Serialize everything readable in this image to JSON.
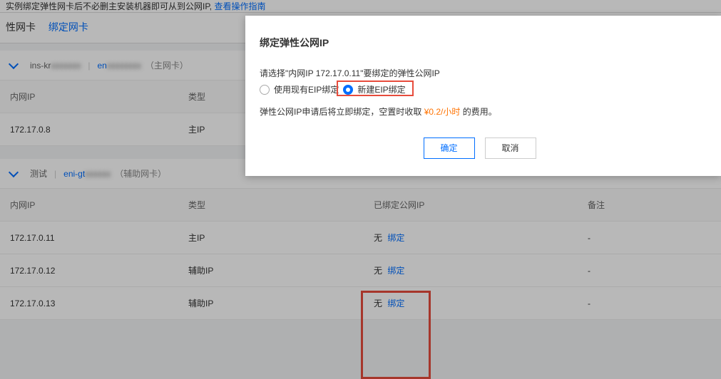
{
  "top_bar": {
    "left_text": "实例绑定弹性网卡后不必删主安装机器即可从到公网IP, ",
    "link": "查看操作指南"
  },
  "panel": {
    "title": "性网卡",
    "bind_link": "绑定网卡"
  },
  "card1": {
    "instance_prefix": "ins-kr",
    "eni_prefix": "en",
    "role": "（主网卡）",
    "headers": {
      "ip": "内网IP",
      "type": "类型"
    },
    "rows": [
      {
        "ip": "172.17.0.8",
        "type": "主IP"
      }
    ]
  },
  "card2": {
    "label": "测试",
    "eni_prefix": "eni-gt",
    "role": "（辅助网卡）",
    "headers": {
      "ip": "内网IP",
      "type": "类型",
      "eip": "已绑定公网IP",
      "note": "备注"
    },
    "rows": [
      {
        "ip": "172.17.0.11",
        "type": "主IP",
        "eip_none": "无",
        "eip_bind": "绑定",
        "note": "-"
      },
      {
        "ip": "172.17.0.12",
        "type": "辅助IP",
        "eip_none": "无",
        "eip_bind": "绑定",
        "note": "-"
      },
      {
        "ip": "172.17.0.13",
        "type": "辅助IP",
        "eip_none": "无",
        "eip_bind": "绑定",
        "note": "-"
      }
    ]
  },
  "modal": {
    "title": "绑定弹性公网IP",
    "subtitle": "请选择\"内网IP 172.17.0.11\"要绑定的弹性公网IP",
    "radio_existing": "使用现有EIP绑定",
    "radio_new": "新建EIP绑定",
    "fee_prefix": "弹性公网IP申请后将立即绑定，空置时收取",
    "fee_price": "¥0.2/小时",
    "fee_suffix": "的费用。",
    "ok": "确定",
    "cancel": "取消"
  }
}
